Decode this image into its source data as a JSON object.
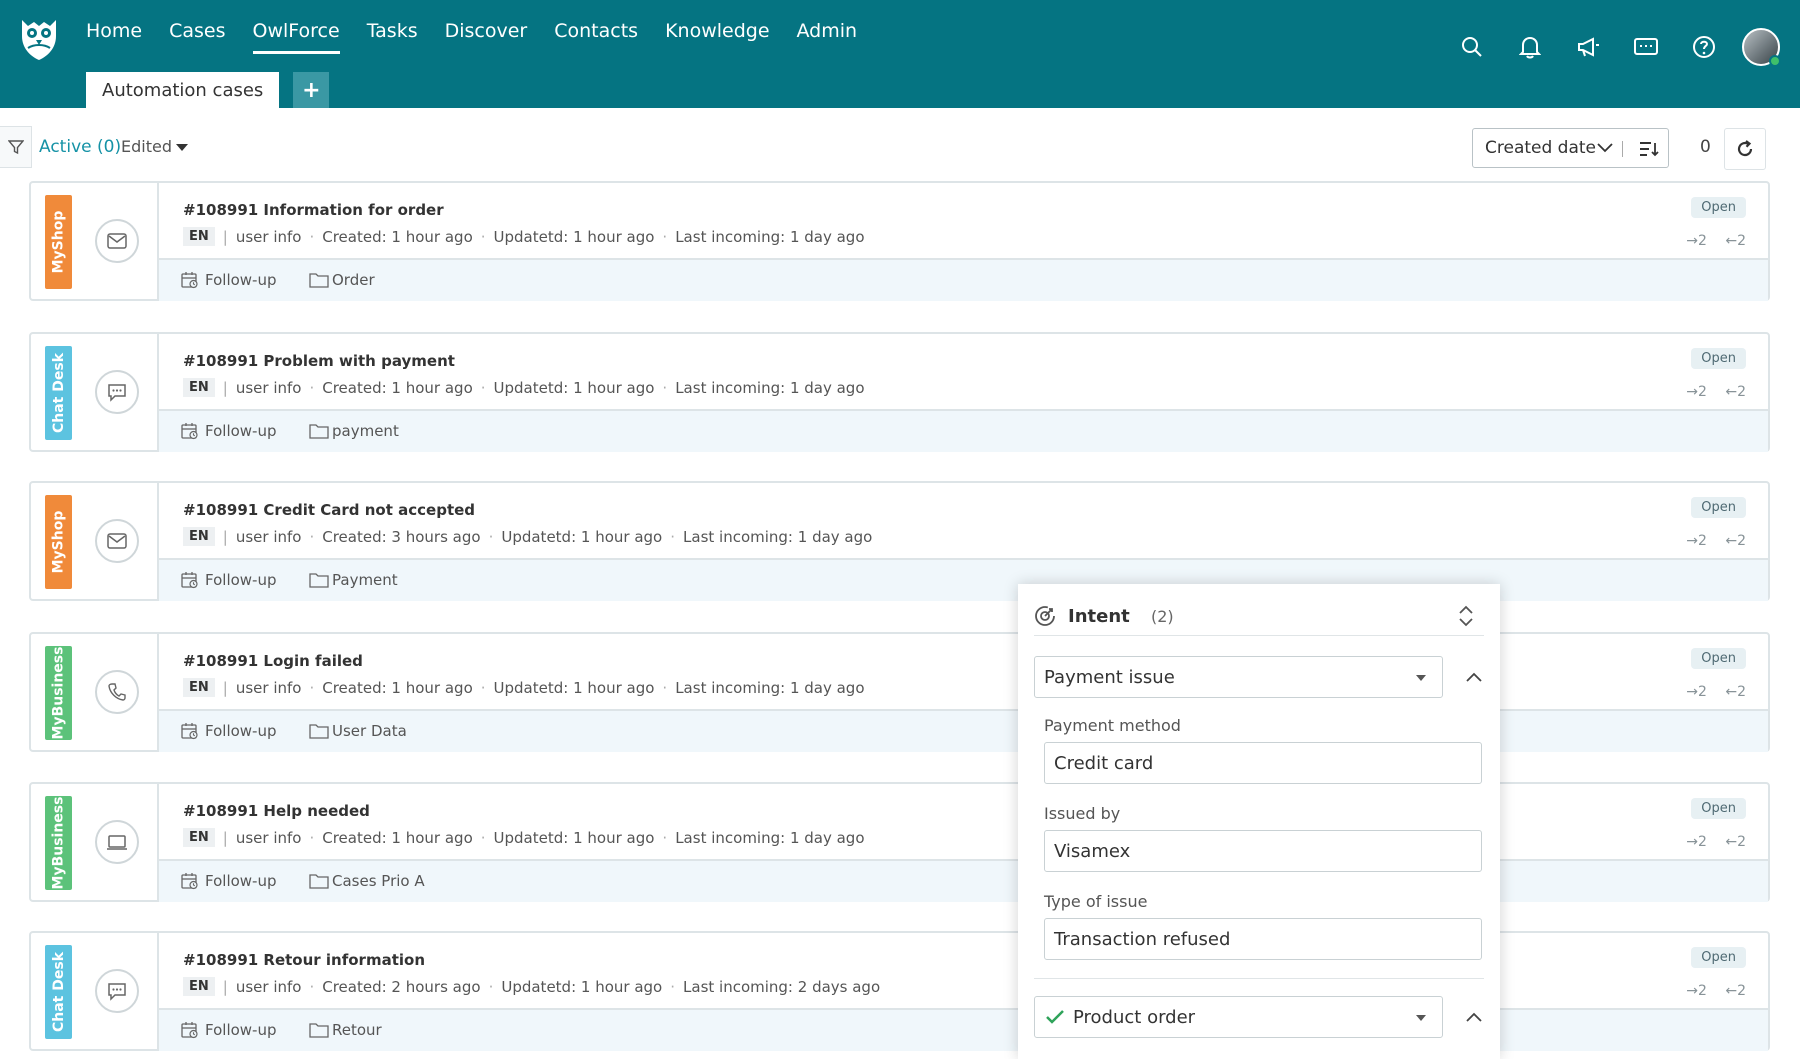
{
  "nav": {
    "items": [
      "Home",
      "Cases",
      "OwlForce",
      "Tasks",
      "Discover",
      "Contacts",
      "Knowledge",
      "Admin"
    ],
    "active": "OwlForce"
  },
  "tab": {
    "label": "Automation cases",
    "add_label": "+"
  },
  "filter": {
    "active_label": "Active",
    "active_count": "(0)",
    "edited_label": "Edited"
  },
  "sort": {
    "label": "Created date"
  },
  "count": "0",
  "cases": [
    {
      "channel": "MyShop",
      "channel_color": "#f08a3a",
      "channel_icon": "mail-icon",
      "title": "#108991 Information for order",
      "lang": "EN",
      "user": "user info",
      "created": "Created: 1 hour ago",
      "updated": "Updatetd: 1 hour ago",
      "incoming": "Last incoming: 1 day ago",
      "followup": "Follow-up",
      "folder": "Order",
      "status": "Open",
      "out": "2",
      "in": "2"
    },
    {
      "channel": "Chat Desk",
      "channel_color": "#5cc3e0",
      "channel_icon": "chat-icon",
      "title": "#108991 Problem with payment",
      "lang": "EN",
      "user": "user info",
      "created": "Created: 1 hour ago",
      "updated": "Updatetd: 1 hour ago",
      "incoming": "Last incoming: 1 day ago",
      "followup": "Follow-up",
      "folder": "payment",
      "status": "Open",
      "out": "2",
      "in": "2"
    },
    {
      "channel": "MyShop",
      "channel_color": "#f08a3a",
      "channel_icon": "mail-icon",
      "title": "#108991 Credit Card not accepted",
      "lang": "EN",
      "user": "user info",
      "created": "Created: 3 hours ago",
      "updated": "Updatetd: 1 hour ago",
      "incoming": "Last incoming: 1 day ago",
      "followup": "Follow-up",
      "folder": "Payment",
      "status": "Open",
      "out": "2",
      "in": "2"
    },
    {
      "channel": "MyBusiness",
      "channel_color": "#5cc27a",
      "channel_icon": "phone-icon",
      "title": "#108991 Login failed",
      "lang": "EN",
      "user": "user info",
      "created": "Created: 1 hour ago",
      "updated": "Updatetd: 1 hour ago",
      "incoming": "Last incoming: 1 day ago",
      "followup": "Follow-up",
      "folder": "User Data",
      "status": "Open",
      "out": "2",
      "in": "2"
    },
    {
      "channel": "MyBusiness",
      "channel_color": "#5cc27a",
      "channel_icon": "laptop-icon",
      "title": "#108991 Help needed",
      "lang": "EN",
      "user": "user info",
      "created": "Created: 1 hour ago",
      "updated": "Updatetd: 1 hour ago",
      "incoming": "Last incoming: 1 day ago",
      "followup": "Follow-up",
      "folder": "Cases Prio A",
      "status": "Open",
      "out": "2",
      "in": "2"
    },
    {
      "channel": "Chat Desk",
      "channel_color": "#5cc3e0",
      "channel_icon": "chat-icon",
      "title": "#108991 Retour information",
      "lang": "EN",
      "user": "user info",
      "created": "Created: 2 hours ago",
      "updated": "Updatetd: 1 hour ago",
      "incoming": "Last incoming: 2 days ago",
      "followup": "Follow-up",
      "folder": "Retour",
      "status": "Open",
      "out": "2",
      "in": "2"
    }
  ],
  "intent_panel": {
    "title": "Intent",
    "count": "(2)",
    "intent1": "Payment issue",
    "fields": [
      {
        "label": "Payment method",
        "value": "Credit card"
      },
      {
        "label": "Issued by",
        "value": "Visamex"
      },
      {
        "label": "Type of issue",
        "value": "Transaction refused"
      }
    ],
    "intent2": "Product order"
  }
}
